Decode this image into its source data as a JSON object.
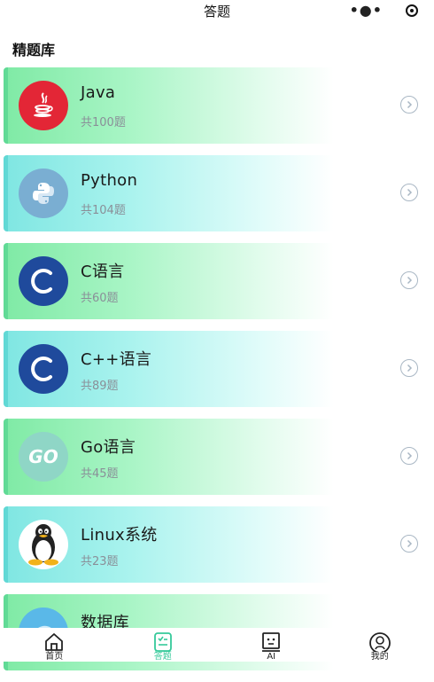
{
  "header": {
    "title": "答题"
  },
  "section": {
    "title": "精题库"
  },
  "cards": [
    {
      "name": "Java",
      "count": "共100题",
      "logo": "java-logo",
      "logo_bg": "#e32636",
      "theme": "g"
    },
    {
      "name": "Python",
      "count": "共104题",
      "logo": "python-logo",
      "logo_bg": "#7aaed2",
      "theme": "c"
    },
    {
      "name": "C语言",
      "count": "共60题",
      "logo": "c-logo",
      "logo_bg": "#1f4a9c",
      "theme": "g"
    },
    {
      "name": "C++语言",
      "count": "共89题",
      "logo": "cpp-logo",
      "logo_bg": "#1f4a9c",
      "theme": "c"
    },
    {
      "name": "Go语言",
      "count": "共45题",
      "logo": "go-logo",
      "logo_bg": "#8fd6c6",
      "theme": "g",
      "logo_text": "GO"
    },
    {
      "name": "Linux系统",
      "count": "共23题",
      "logo": "linux-logo",
      "logo_bg": "#ffffff",
      "theme": "c"
    },
    {
      "name": "数据库",
      "count": "",
      "logo": "database-logo",
      "logo_bg": "#5ab8e8",
      "theme": "g"
    }
  ],
  "tabbar": {
    "items": [
      {
        "label": "首页",
        "icon": "home-icon"
      },
      {
        "label": "答题",
        "icon": "quiz-icon",
        "active": true
      },
      {
        "label": "AI",
        "icon": "robot-icon"
      },
      {
        "label": "我的",
        "icon": "profile-icon"
      }
    ]
  },
  "colors": {
    "accent": "#35c99a",
    "card_green": "#7feaa5",
    "card_cyan": "#7fe6e2"
  }
}
